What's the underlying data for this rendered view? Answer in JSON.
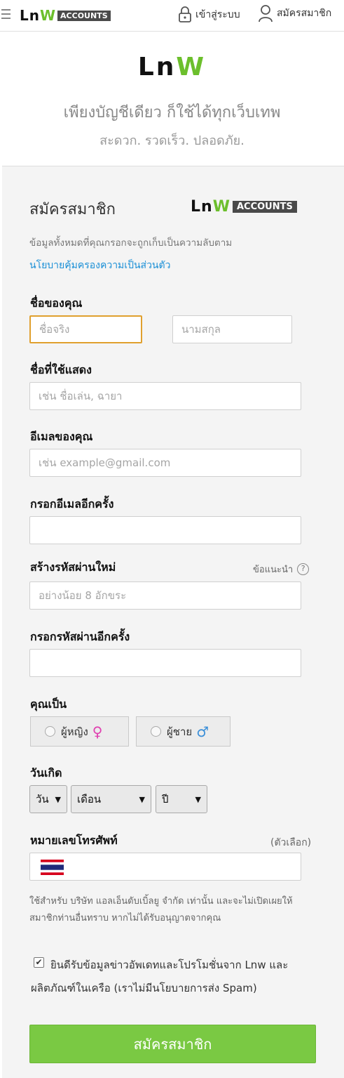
{
  "header": {
    "logo_text_ln": "Ln",
    "logo_text_w": "W",
    "logo_badge": "ACCOUNTS",
    "login_label": "เข้าสู่ระบบ",
    "register_label": "สมัครสมาชิก"
  },
  "hero": {
    "logo_ln": "Ln",
    "logo_w": "W",
    "tagline": "เพียงบัญชีเดียว ก็ใช้ได้ทุกเว็บเทพ",
    "subtagline": "สะดวก. รวดเร็ว. ปลอดภัย."
  },
  "form": {
    "title": "สมัครสมาชิก",
    "logo_ln": "Ln",
    "logo_w": "W",
    "logo_badge": "ACCOUNTS",
    "privacy_text": "ข้อมูลทั้งหมดที่คุณกรอกจะถูกเก็บเป็นความลับตาม",
    "privacy_link": "นโยบายคุ้มครองความเป็นส่วนตัว",
    "name_label": "ชื่อของคุณ",
    "first_name_placeholder": "ชื่อจริง",
    "last_name_placeholder": "นามสกุล",
    "display_name_label": "ชื่อที่ใช้แสดง",
    "display_name_placeholder": "เช่น ชื่อเล่น, ฉายา",
    "email_label": "อีเมลของคุณ",
    "email_placeholder": "เช่น example@gmail.com",
    "email_confirm_label": "กรอกอีเมลอีกครั้ง",
    "password_label": "สร้างรหัสผ่านใหม่",
    "password_hint": "ข้อแนะนำ",
    "password_placeholder": "อย่างน้อย 8 อักขระ",
    "password_confirm_label": "กรอกรหัสผ่านอีกครั้ง",
    "gender_label": "คุณเป็น",
    "gender_female": "ผู้หญิง",
    "gender_male": "ผู้ชาย",
    "birthday_label": "วันเกิด",
    "day_select": "วัน",
    "month_select": "เดือน",
    "year_select": "ปี",
    "phone_label": "หมายเลขโทรศัพท์",
    "phone_optional": "(ตัวเลือก)",
    "phone_note": "ใช้สำหรับ บริษัท แอลเอ็นดับเบิ้ลยู จำกัด เท่านั้น และจะไม่เปิดเผยให้สมาชิกท่านอื่นทราบ หากไม่ได้รับอนุญาตจากคุณ",
    "newsletter_text": "ยินดีรับข้อมูลข่าวอัพเดทและโปรโมชั่นจาก Lnw และผลิตภัณฑ์ในเครือ (เราไม่มีนโยบายการส่ง Spam)",
    "newsletter_checked": true,
    "submit_label": "สมัครสมาชิก"
  },
  "colors": {
    "brand_green": "#6cbf2c",
    "submit_green": "#7ac943",
    "link_blue": "#1a8fd6",
    "focus_orange": "#e0a02e",
    "female_pink": "#e040b0",
    "male_blue": "#3b8fd8"
  },
  "icons": [
    "hamburger-icon",
    "lock-icon",
    "user-icon",
    "help-icon",
    "female-symbol-icon",
    "male-symbol-icon",
    "thailand-flag-icon",
    "checkbox-checked-icon"
  ]
}
